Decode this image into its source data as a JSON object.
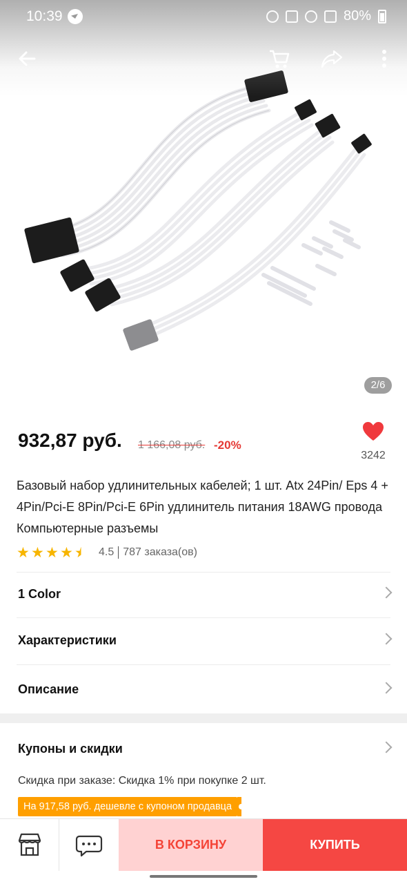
{
  "status_bar": {
    "time": "10:39",
    "battery": "80%",
    "icons": [
      "telegram-icon",
      "alarm-icon",
      "mute-icon",
      "wifi-icon",
      "signal-icon",
      "battery-icon"
    ]
  },
  "app_bar": {
    "icons": [
      "back-arrow-icon",
      "cart-icon",
      "share-icon",
      "more-vertical-icon"
    ]
  },
  "gallery": {
    "counter": "2/6"
  },
  "price": {
    "current": "932,87 руб.",
    "old": "1 166,08 руб.",
    "discount": "-20%"
  },
  "wishlist": {
    "count": "3242"
  },
  "product": {
    "title": "Базовый набор удлинительных кабелей; 1 шт. Atx 24Pin/ Eps 4 + 4Pin/Pci-E 8Pin/Pci-E 6Pin удлинитель питания 18AWG провода Компьютерные разъемы",
    "rating": "4.5",
    "rating_value": 4.5,
    "orders": "787 заказа(ов)"
  },
  "sections": {
    "color": "1 Color",
    "specs": "Характеристики",
    "description": "Описание",
    "coupons": "Купоны и скидки"
  },
  "promo": {
    "order_discount": "Скидка при заказе: Скидка 1% при покупке 2 шт.",
    "coupon": "На 917,58 руб. дешевле с купоном продавца"
  },
  "bottom_bar": {
    "add_to_cart": "В КОРЗИНУ",
    "buy": "КУПИТЬ"
  },
  "colors": {
    "accent": "#f54743",
    "cart_bg": "#ffd2d2",
    "coupon": "#ff9f00",
    "star": "#f7b500"
  }
}
